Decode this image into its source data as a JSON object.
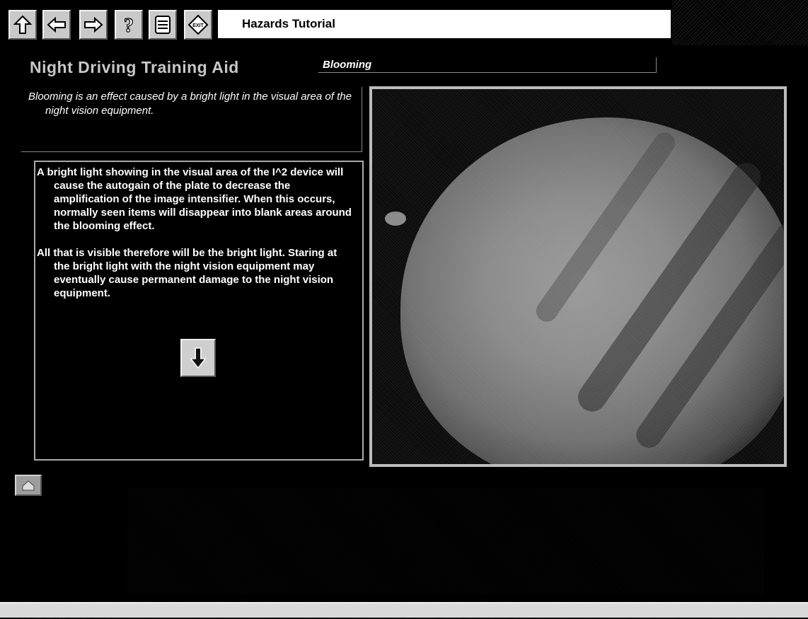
{
  "window": {
    "title": "Hazards Tutorial"
  },
  "toolbar": {
    "buttons": [
      {
        "icon": "up-arrow-icon",
        "label": ""
      },
      {
        "icon": "back-arrow-icon",
        "label": ""
      },
      {
        "icon": "forward-arrow-icon",
        "label": ""
      },
      {
        "icon": "help-icon",
        "label": "?"
      },
      {
        "icon": "glossary-icon",
        "label": ""
      },
      {
        "icon": "exit-icon",
        "label": "EXIT"
      }
    ]
  },
  "header": {
    "app_title": "Night Driving Training Aid",
    "topic": "Blooming"
  },
  "summary": {
    "text": "Blooming is an effect caused by a bright light in the visual area of the night vision equipment."
  },
  "detail": {
    "paragraph_1": "A bright light showing in the visual area of the I^2 device will cause the autogain of the plate to decrease the amplification of the image intensifier.  When this occurs, normally seen items will disappear into blank areas around the blooming effect.",
    "paragraph_2": "All that is visible therefore will be the bright light.  Staring at the bright light with the night vision equipment may eventually cause permanent damage to the night vision equipment.",
    "next_icon": "down-arrow-icon"
  },
  "image_panel": {
    "icon": "night-vision-image"
  },
  "footer": {
    "left_button_icon": "home-icon"
  },
  "colors": {
    "background": "#000000",
    "title_bar": "#ffffff",
    "button_face": "#c9c9c9"
  }
}
